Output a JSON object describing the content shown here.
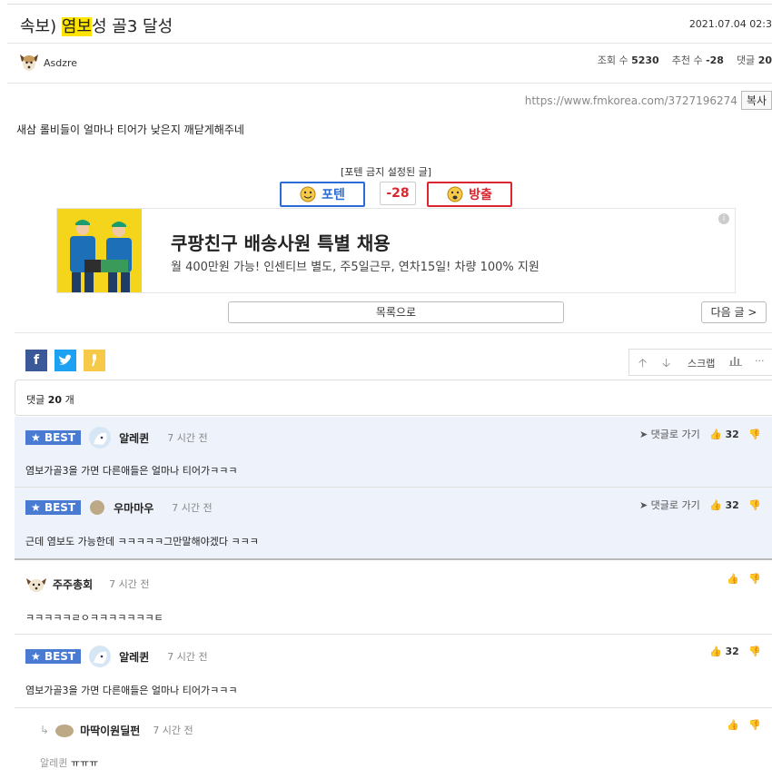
{
  "post": {
    "title_prefix": "속보) ",
    "title_highlight": "염보",
    "title_suffix": "성 골3 달성",
    "date": "2021.07.04 02:3",
    "author": "Asdzre",
    "views_label": "조회 수",
    "views": "5230",
    "recommend_label": "추천 수",
    "recommend": "-28",
    "comments_label": "댓글",
    "comments": "20",
    "url": "https://www.fmkorea.com/3727196274",
    "copy_label": "복사",
    "content": "새삼 롤비들이 얼마나 티어가 낮은지 깨닫게해주네",
    "potenban_label": "[포텐 금지 설정된 글]",
    "poten_label": "포텐",
    "vote_count": "-28",
    "banish_label": "방출"
  },
  "ad": {
    "title": "쿠팡친구 배송사원 특별 채용",
    "desc": "월 400만원 가능! 인센티브 별도, 주5일근무, 연차15일! 차량 100% 지원",
    "info_icon": "i"
  },
  "nav": {
    "list_label": "목록으로",
    "next_label": "다음 글 >"
  },
  "toolbar": {
    "scrap_label": "스크랩",
    "more_label": "···"
  },
  "comment_header": {
    "label": "댓글",
    "count": "20",
    "unit": "개"
  },
  "comments": [
    {
      "best": "BEST",
      "nick": "알레퀸",
      "time": "7 시간 전",
      "text": "염보가골3을 가면 다른애들은 얼마나 티어가ㅋㅋㅋ",
      "reply_label": "댓글로 가기",
      "likes": "32"
    },
    {
      "best": "BEST",
      "nick": "우마마우",
      "time": "7 시간 전",
      "text": "근데 염보도 가능한데 ㅋㅋㅋㅋㅋ그만말해야겠다 ㅋㅋㅋ",
      "reply_label": "댓글로 가기",
      "likes": "32"
    },
    {
      "nick": "주주총회",
      "time": "7 시간 전",
      "text": "ㅋㅋㅋㅋㅋㄹㅇㅋㅋㅋㅋㅋㅋㅋㅌ"
    },
    {
      "best": "BEST",
      "nick": "알레퀸",
      "time": "7 시간 전",
      "text": "염보가골3을 가면 다른애들은 얼마나 티어가ㅋㅋㅋ",
      "likes": "32"
    },
    {
      "nick": "마딱이원딜펀",
      "time": "7 시간 전",
      "reply_to": "알레퀸",
      "text": "ㅠㅠㅠ"
    }
  ],
  "colors": {
    "highlight": "#ffe400",
    "best_badge": "#4a7bd3",
    "best_bg": "#eef2fb",
    "poten_border": "#2a6bd6",
    "banish_border": "#d9262f",
    "facebook": "#3b5998",
    "twitter": "#1da1f2",
    "kakao": "#f7c948"
  }
}
